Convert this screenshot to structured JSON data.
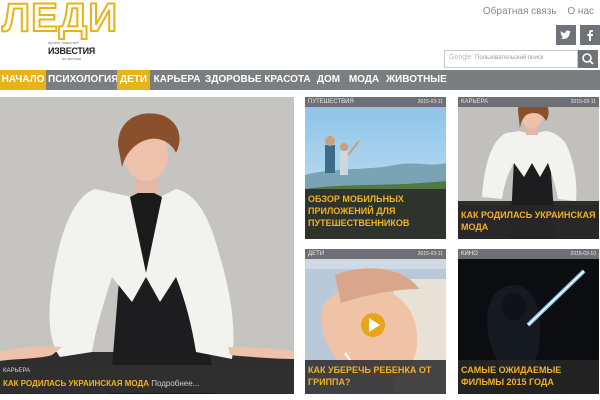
{
  "header": {
    "logo_text": "ЛЕДИ",
    "logo_sub": "ИЗВЕСТИЯ",
    "logo_micro": "проект новостей",
    "logo_micro2": "по-женски",
    "feedback": "Обратная связь",
    "about": "О нас",
    "search_brand": "Google",
    "search_placeholder": "Пользовательский поиск"
  },
  "nav": {
    "items": [
      {
        "label": "НАЧАЛО"
      },
      {
        "label": "ПСИХОЛОГИЯ"
      },
      {
        "label": "ДЕТИ"
      },
      {
        "label": "КАРЬЕРА"
      },
      {
        "label": "ЗДОРОВЬЕ"
      },
      {
        "label": "КРАСОТА"
      },
      {
        "label": "ДОМ"
      },
      {
        "label": "МОДА"
      },
      {
        "label": "ЖИВОТНЫЕ"
      }
    ]
  },
  "hero": {
    "category": "КАРЬЕРА",
    "title": "КАК РОДИЛАСЬ УКРАИНСКАЯ МОДА",
    "more": "Подробнее..."
  },
  "tiles": [
    {
      "category": "ПУТЕШЕСТВИЯ",
      "date": "2015-03-11",
      "title": "ОБЗОР МОБИЛЬНЫХ ПРИЛОЖЕНИЙ ДЛЯ ПУТЕШЕСТВЕННИКОВ"
    },
    {
      "category": "КАРЬЕРА",
      "date": "2015-03-11",
      "title": "КАК РОДИЛАСЬ УКРАИНСКАЯ МОДА"
    },
    {
      "category": "ДЕТИ",
      "date": "2015-03-11",
      "title": "КАК УБЕРЕЧЬ РЕБЕНКА ОТ ГРИППА?"
    },
    {
      "category": "КИНО",
      "date": "2015-03-10",
      "title": "САМЫЕ ОЖИДАЕМЫЕ ФИЛЬМЫ 2015 ГОДА"
    }
  ],
  "colors": {
    "accent": "#e8b317",
    "nav_bg": "#7b7e81",
    "tile_title": "#f0b224"
  }
}
